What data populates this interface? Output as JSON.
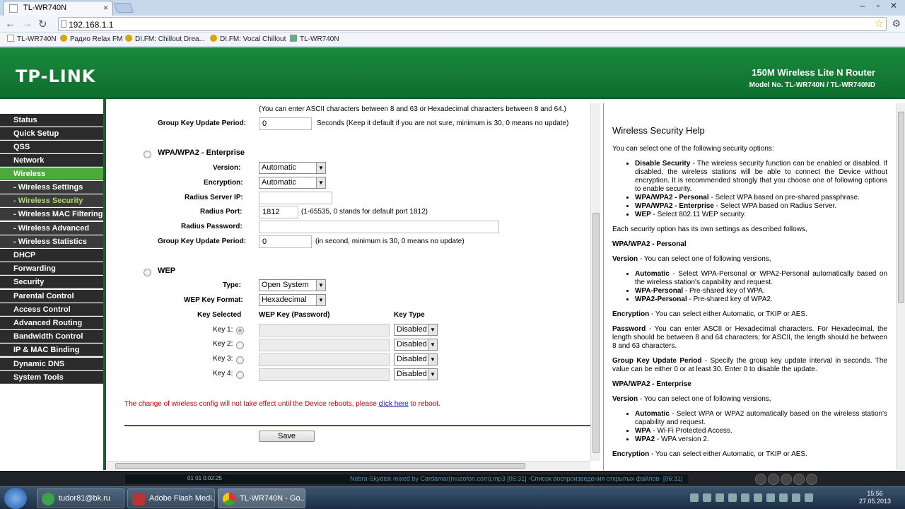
{
  "browser": {
    "tab_title": "TL-WR740N",
    "url": "192.168.1.1",
    "bookmarks": [
      "TL-WR740N",
      "Радио Relax FM",
      "DI.FM: Chillout Drea...",
      "DI.FM: Vocal Chillout",
      "TL-WR740N"
    ]
  },
  "header": {
    "logo": "TP-LINK",
    "product": "150M Wireless Lite N Router",
    "model": "Model No. TL-WR740N / TL-WR740ND"
  },
  "menu": [
    {
      "label": "Status"
    },
    {
      "label": "Quick Setup"
    },
    {
      "label": "QSS"
    },
    {
      "label": "Network"
    },
    {
      "label": "Wireless"
    },
    {
      "label": "- Wireless Settings"
    },
    {
      "label": "- Wireless Security"
    },
    {
      "label": "- Wireless MAC Filtering"
    },
    {
      "label": "- Wireless Advanced"
    },
    {
      "label": "- Wireless Statistics"
    },
    {
      "label": "DHCP"
    },
    {
      "label": "Forwarding"
    },
    {
      "label": "Security"
    },
    {
      "label": "Parental Control"
    },
    {
      "label": "Access Control"
    },
    {
      "label": "Advanced Routing"
    },
    {
      "label": "Bandwidth Control"
    },
    {
      "label": "IP & MAC Binding"
    },
    {
      "label": "Dynamic DNS"
    },
    {
      "label": "System Tools"
    }
  ],
  "form": {
    "top_note": "(You can enter ASCII characters between 8 and 63 or Hexadecimal characters between 8 and 64.)",
    "personal_group_key_label": "Group Key Update Period:",
    "personal_group_key_value": "0",
    "personal_group_key_note": "Seconds (Keep it default if you are not sure, minimum is 30, 0 means no update)",
    "enterprise_title": "WPA/WPA2 - Enterprise",
    "version_label": "Version:",
    "version_value": "Automatic",
    "encryption_label": "Encryption:",
    "encryption_value": "Automatic",
    "radius_ip_label": "Radius Server IP:",
    "radius_ip_value": "",
    "radius_port_label": "Radius Port:",
    "radius_port_value": "1812",
    "radius_port_note": "(1-65535, 0 stands for default port 1812)",
    "radius_pw_label": "Radius Password:",
    "radius_pw_value": "",
    "ent_group_key_label": "Group Key Update Period:",
    "ent_group_key_value": "0",
    "ent_group_key_note": "(in second, minimum is 30, 0 means no update)",
    "wep_title": "WEP",
    "type_label": "Type:",
    "type_value": "Open System",
    "key_format_label": "WEP Key Format:",
    "key_format_value": "Hexadecimal",
    "col_key_selected": "Key Selected",
    "col_wep_key": "WEP Key (Password)",
    "col_key_type": "Key Type",
    "keys": [
      {
        "label": "Key 1:",
        "type": "Disabled"
      },
      {
        "label": "Key 2:",
        "type": "Disabled"
      },
      {
        "label": "Key 3:",
        "type": "Disabled"
      },
      {
        "label": "Key 4:",
        "type": "Disabled"
      }
    ],
    "reboot_text_before": "The change of wireless config will not take effect until the Device reboots, please ",
    "reboot_link": "click here",
    "reboot_text_after": " to reboot.",
    "save_label": "Save"
  },
  "help": {
    "title": "Wireless Security Help",
    "intro": "You can select one of the following security options:",
    "options": [
      {
        "term": "Disable Security",
        "desc": " - The wireless security function can be enabled or disabled. If disabled, the wireless stations will be able to connect the Device without encryption. It is recommended strongly that you choose one of following options to enable security."
      },
      {
        "term": "WPA/WPA2 - Personal",
        "desc": " - Select WPA based on pre-shared passphrase."
      },
      {
        "term": "WPA/WPA2 - Enterprise",
        "desc": " - Select WPA based on Radius Server."
      },
      {
        "term": "WEP",
        "desc": " - Select 802.11 WEP security."
      }
    ],
    "each_option": "Each security option has its own settings as described follows,",
    "personal_heading": "WPA/WPA2 - Personal",
    "version_term": "Version",
    "version_desc": " - You can select one of following versions,",
    "personal_versions": [
      {
        "term": "Automatic",
        "desc": " - Select WPA-Personal or WPA2-Personal automatically based on the wireless station's capability and request."
      },
      {
        "term": "WPA-Personal",
        "desc": " - Pre-shared key of WPA."
      },
      {
        "term": "WPA2-Personal",
        "desc": " - Pre-shared key of WPA2."
      }
    ],
    "encryption_term": "Encryption",
    "encryption_desc": " - You can select either Automatic, or TKIP or AES.",
    "password_term": "Password",
    "password_desc": " - You can enter ASCII or Hexadecimal characters. For Hexadecimal, the length should be between 8 and 64 characters; for ASCII, the length should be between 8 and 63 characters.",
    "gkup_term": "Group Key Update Period",
    "gkup_desc": " - Specify the group key update interval in seconds. The value can be either 0 or at least 30. Enter 0 to disable the update.",
    "enterprise_heading": "WPA/WPA2 - Enterprise",
    "enterprise_versions": [
      {
        "term": "Automatic",
        "desc": " - Select WPA or WPA2 automatically based on the wireless station's capability and request."
      },
      {
        "term": "WPA",
        "desc": " - Wi-Fi Protected Access."
      },
      {
        "term": "WPA2",
        "desc": " - WPA version 2."
      }
    ]
  },
  "media": {
    "track": "Nebra-Skydisk mixed by Cardamar(muzofon.com).mp3  [06:31]  -Список воспроизведения открытых файлов-  [06:31]",
    "time": "01   01   0:02:25"
  },
  "taskbar": {
    "items": [
      "tudor81@bk.ru",
      "Adobe Flash Medi...",
      "TL-WR740N - Go..."
    ],
    "time": "15:56",
    "date": "27.05.2013"
  }
}
